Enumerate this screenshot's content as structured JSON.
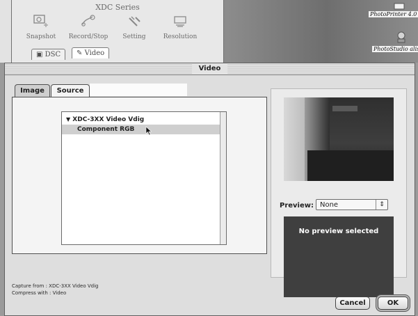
{
  "background_window": {
    "title": "XDC Series",
    "tools": [
      {
        "label": "Snapshot",
        "icon": "camera-icon"
      },
      {
        "label": "Record/Stop",
        "icon": "record-icon"
      },
      {
        "label": "Setting",
        "icon": "tools-icon"
      },
      {
        "label": "Resolution",
        "icon": "resolution-icon"
      }
    ],
    "tabs": [
      {
        "label": "DSC",
        "icon": "dsc-icon"
      },
      {
        "label": "Video",
        "icon": "video-icon"
      }
    ]
  },
  "desktop": {
    "icons": [
      {
        "label": "PhotoPrinter 4.0",
        "icon": "printer-app-icon"
      },
      {
        "label": "PhotoStudio aliss",
        "icon": "studio-app-icon"
      }
    ]
  },
  "dialog": {
    "title": "Video",
    "tabs": [
      {
        "label": "Image"
      },
      {
        "label": "Source"
      }
    ],
    "source_list": {
      "device": "XDC-3XX Video Vdig",
      "item": "Component RGB"
    },
    "preview": {
      "label": "Preview:",
      "selected": "None",
      "empty_message": "No preview selected"
    },
    "capture_from": "Capture from : XDC-3XX Video Vdig",
    "compress_with": "Compress with : Video",
    "buttons": {
      "cancel": "Cancel",
      "ok": "OK"
    }
  }
}
